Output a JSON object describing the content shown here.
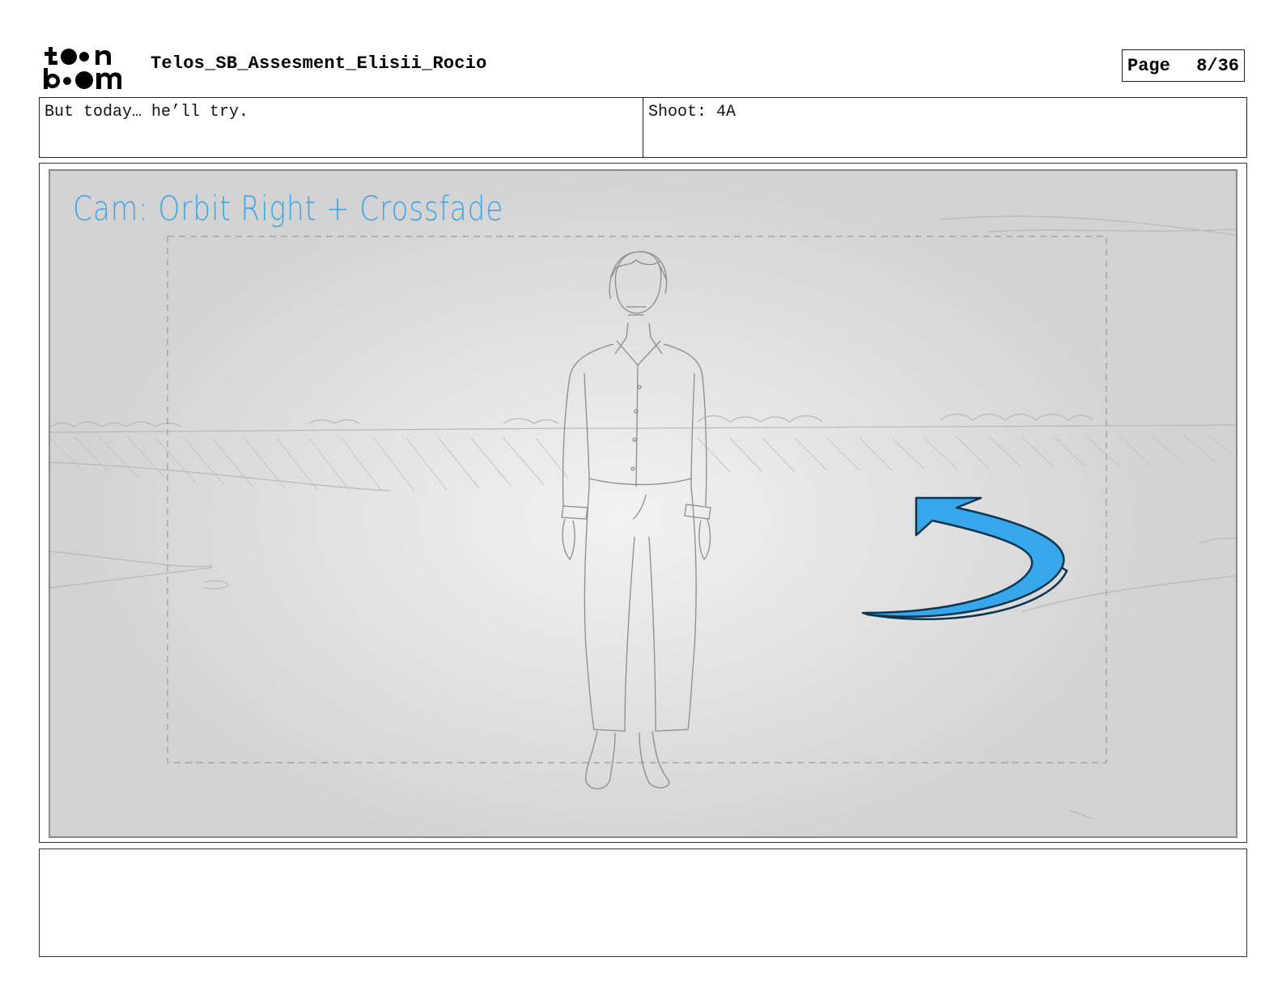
{
  "header": {
    "logo_text": "toon boom",
    "title": "Telos_SB_Assesment_Elisii_Rocio",
    "page_label": "Page",
    "page_number": "8/36"
  },
  "panel_info": {
    "dialogue": "But today… he’ll try.",
    "shot": "Shoot: 4A"
  },
  "panel": {
    "camera_note": "Cam: Orbit Right + Crossfade",
    "accent_color": "#3ea6e8"
  },
  "notes": {
    "text": ""
  }
}
